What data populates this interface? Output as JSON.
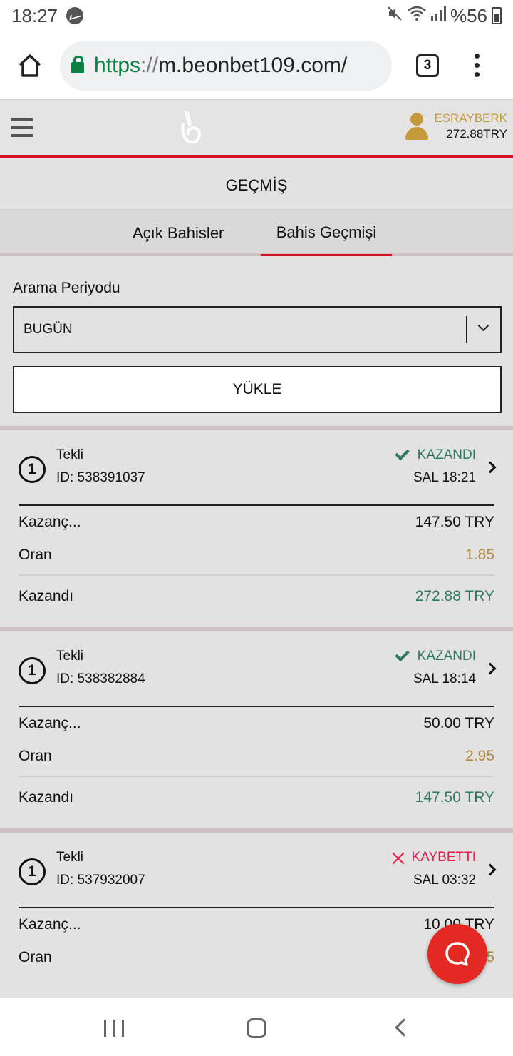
{
  "status_bar": {
    "time": "18:27",
    "battery": "%56"
  },
  "browser": {
    "url_scheme": "https",
    "url_sep": "://",
    "url_host": "m.beonbet109.com/",
    "tab_count": "3"
  },
  "header": {
    "username": "ESRAYBERK",
    "balance": "272.88TRY"
  },
  "page": {
    "title": "GEÇMİŞ"
  },
  "tabs": [
    {
      "label": "Açık Bahisler"
    },
    {
      "label": "Bahis Geçmişi",
      "active": true
    }
  ],
  "filter": {
    "label": "Arama Periyodu",
    "selected": "BUGÜN",
    "load_label": "YÜKLE"
  },
  "labels": {
    "stake": "Kazanç...",
    "odds": "Oran"
  },
  "bets": [
    {
      "num": "1",
      "type": "Tekli",
      "id": "ID: 538391037",
      "status": "KAZANDI",
      "time": "SAL 18:21",
      "stake": "147.50 TRY",
      "odds": "1.85",
      "result_label": "Kazandı",
      "result_value": "272.88 TRY"
    },
    {
      "num": "1",
      "type": "Tekli",
      "id": "ID: 538382884",
      "status": "KAZANDI",
      "time": "SAL 18:14",
      "stake": "50.00 TRY",
      "odds": "2.95",
      "result_label": "Kazandı",
      "result_value": "147.50 TRY"
    },
    {
      "num": "1",
      "type": "Tekli",
      "id": "ID: 537932007",
      "status": "KAYBETTI",
      "time": "SAL 03:32",
      "stake": "10.00 TRY",
      "odds": "2.15"
    }
  ],
  "colors": {
    "accent_red": "#d4101a",
    "win_green": "#2d7a5e",
    "lose_red": "#e41b4a",
    "gold": "#c59a3c",
    "odds_gold": "#b28840",
    "chat_red": "#e32a22"
  },
  "icons": [
    "messenger-icon",
    "mute-icon",
    "wifi-icon",
    "signal-icon",
    "battery-icon",
    "home-icon",
    "lock-icon",
    "tabs-icon",
    "more-icon",
    "hamburger-icon",
    "logo",
    "user-icon",
    "chevron-down-icon",
    "check-icon",
    "close-icon",
    "chevron-right-icon",
    "chat-icon",
    "recent-apps-icon",
    "home-nav-icon",
    "back-icon"
  ]
}
